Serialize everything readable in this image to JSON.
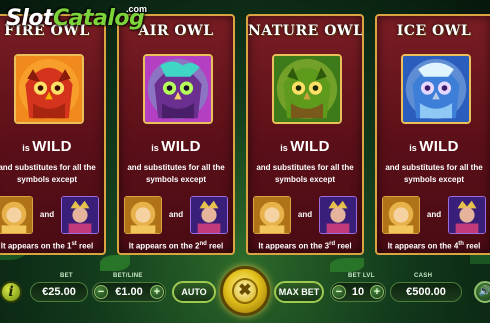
{
  "logo": {
    "part1": "Slot",
    "part2": "Catalog",
    "suffix": ".com"
  },
  "panels": [
    {
      "title": "FIRE OWL",
      "is": "is",
      "wild": "WILD",
      "substitutes": "and substitutes for all the symbols except",
      "and": "and",
      "appears_pre": "It appears on the 1",
      "ordinal": "st",
      "appears_post": " reel during the base game only.",
      "colors": {
        "owl": "#d5341c",
        "glow": "#ffb23a",
        "bg": "#f08a1c"
      }
    },
    {
      "title": "AIR OWL",
      "is": "is",
      "wild": "WILD",
      "substitutes": "and substitutes for all the symbols except",
      "and": "and",
      "appears_pre": "It appears on the 2",
      "ordinal": "nd",
      "appears_post": " reel during the base game only.",
      "colors": {
        "owl": "#6b2f8f",
        "glow": "#3fd6c6",
        "bg": "#b53fc2"
      }
    },
    {
      "title": "NATURE OWL",
      "is": "is",
      "wild": "WILD",
      "substitutes": "and substitutes for all the symbols except",
      "and": "and",
      "appears_pre": "It appears on the 3",
      "ordinal": "rd",
      "appears_post": " reel during the base game only.",
      "colors": {
        "owl": "#5e9a1b",
        "glow": "#d9e845",
        "bg": "#3d7a1a"
      }
    },
    {
      "title": "ICE OWL",
      "is": "is",
      "wild": "WILD",
      "substitutes": "and substitutes for all the symbols except",
      "and": "and",
      "appears_pre": "It appears on the 4",
      "ordinal": "th",
      "appears_post": " reel during the base game only.",
      "colors": {
        "owl": "#3d7ed9",
        "glow": "#bfe9ff",
        "bg": "#2b5dbd"
      }
    }
  ],
  "controls": {
    "info_icon": "i",
    "bet": {
      "label": "BET",
      "value": "€25.00"
    },
    "bet_line": {
      "label": "BET/LINE",
      "value": "€1.00",
      "minus": "−",
      "plus": "+"
    },
    "auto": "AUTO",
    "spin_icon": "✖",
    "max_bet": "MAX BET",
    "bet_lvl": {
      "label": "BET LVL",
      "value": "10",
      "minus": "−",
      "plus": "+"
    },
    "cash": {
      "label": "CASH",
      "value": "€500.00"
    },
    "sound_icon": "🔊"
  }
}
